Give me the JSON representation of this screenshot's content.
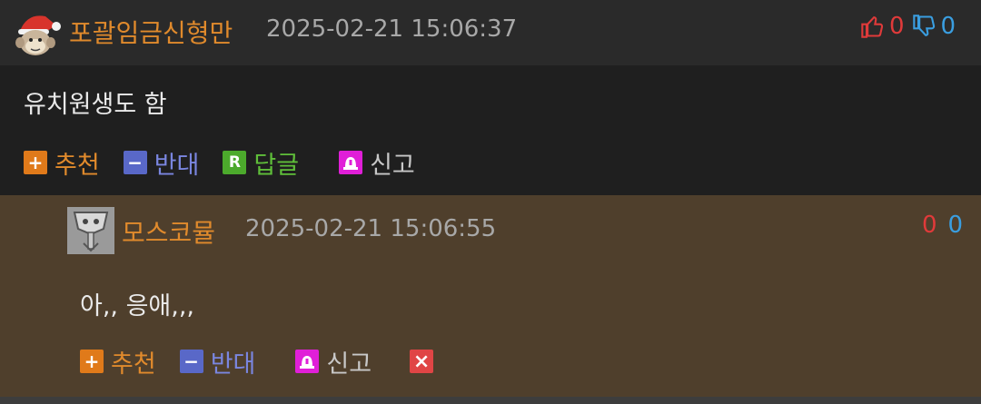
{
  "comments": [
    {
      "nickname": "포괄임금신형만",
      "datetime": "2025-02-21 15:06:37",
      "upvotes": "0",
      "downvotes": "0",
      "body": "유치원생도 함",
      "actions": {
        "up": "추천",
        "down": "반대",
        "reply": "답글",
        "report": "신고"
      }
    },
    {
      "nickname": "모스코뮬",
      "datetime": "2025-02-21 15:06:55",
      "upvotes": "0",
      "downvotes": "0",
      "body": "아,, 응애,,,",
      "actions": {
        "up": "추천",
        "down": "반대",
        "report": "신고"
      }
    }
  ],
  "icons": {
    "avatar1": "monkey-santa-hat-avatar",
    "avatar2": "skull-crest-avatar",
    "thumb_up": "thumbs-up-icon",
    "thumb_down": "thumbs-down-icon",
    "plus": "plus-icon",
    "minus": "minus-icon",
    "reply": "reply-r-icon",
    "report": "siren-icon",
    "delete": "close-icon"
  },
  "colors": {
    "nickname": "#e08a2c",
    "upvote": "#e03a3a",
    "downvote": "#3a9ee0",
    "reply_bg": "#4f3f2c"
  }
}
